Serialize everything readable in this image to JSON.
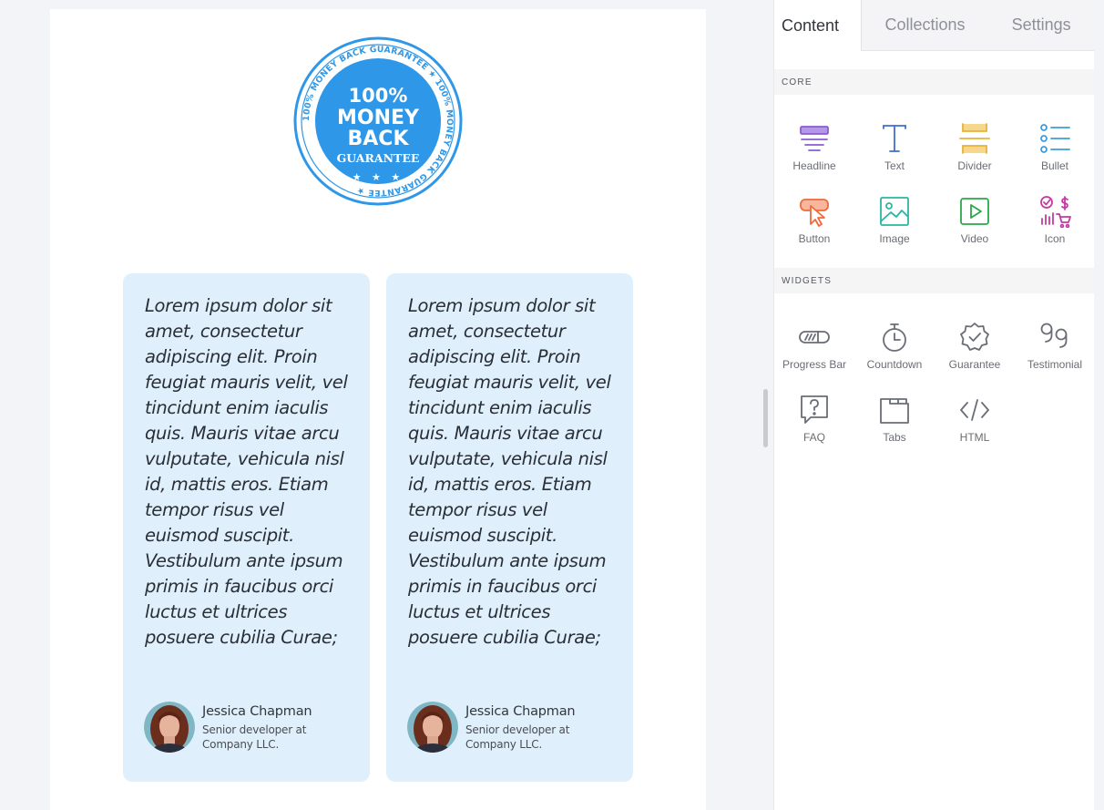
{
  "badge": {
    "ring_text": "100% MONEY BACK GUARANTEE ★ 100% MONEY BACK GUARANTEE ★",
    "line1": "100%",
    "line2": "MONEY",
    "line3": "BACK",
    "line4": "GUARANTEE",
    "stars": "★ ★ ★",
    "color": "#2f97e8"
  },
  "testimonials": [
    {
      "quote": "Lorem ipsum dolor sit amet, consectetur adipiscing elit. Proin feugiat mauris velit, vel tincidunt enim iaculis quis. Mauris vitae arcu vulputate, vehicula nisl id, mattis eros. Etiam tempor risus vel euismod suscipit. Vestibulum ante ipsum primis in faucibus orci luctus et ultrices posuere cubilia Curae;",
      "name": "Jessica Chapman",
      "role": "Senior developer at Company LLC."
    },
    {
      "quote": "Lorem ipsum dolor sit amet, consectetur adipiscing elit. Proin feugiat mauris velit, vel tincidunt enim iaculis quis. Mauris vitae arcu vulputate, vehicula nisl id, mattis eros. Etiam tempor risus vel euismod suscipit. Vestibulum ante ipsum primis in faucibus orci luctus et ultrices posuere cubilia Curae;",
      "name": "Jessica Chapman",
      "role": "Senior developer at Company LLC."
    }
  ],
  "panel": {
    "tabs": [
      "Content",
      "Collections",
      "Settings"
    ],
    "active_tab": "Content",
    "core_label": "CORE",
    "widgets_label": "WIDGETS",
    "core": [
      {
        "label": "Headline",
        "icon": "headline-icon",
        "color": "#8a5cd1"
      },
      {
        "label": "Text",
        "icon": "text-icon",
        "color": "#3f6fcf"
      },
      {
        "label": "Divider",
        "icon": "divider-icon",
        "color": "#e8b23a"
      },
      {
        "label": "Bullet",
        "icon": "bullet-icon",
        "color": "#3a9fd9"
      },
      {
        "label": "Button",
        "icon": "button-icon",
        "color": "#ef6a3c"
      },
      {
        "label": "Image",
        "icon": "image-icon",
        "color": "#2bb5a3"
      },
      {
        "label": "Video",
        "icon": "video-icon",
        "color": "#2aa84a"
      },
      {
        "label": "Icon",
        "icon": "icon-icon",
        "color": "#c43aa0"
      }
    ],
    "widgets": [
      {
        "label": "Progress Bar",
        "icon": "progress-bar-icon"
      },
      {
        "label": "Countdown",
        "icon": "stopwatch-icon"
      },
      {
        "label": "Guarantee",
        "icon": "guarantee-seal-icon"
      },
      {
        "label": "Testimonial",
        "icon": "quote-icon"
      },
      {
        "label": "FAQ",
        "icon": "faq-icon"
      },
      {
        "label": "Tabs",
        "icon": "tabs-icon"
      },
      {
        "label": "HTML",
        "icon": "code-icon"
      }
    ],
    "widget_icon_color": "#6a6d75"
  }
}
